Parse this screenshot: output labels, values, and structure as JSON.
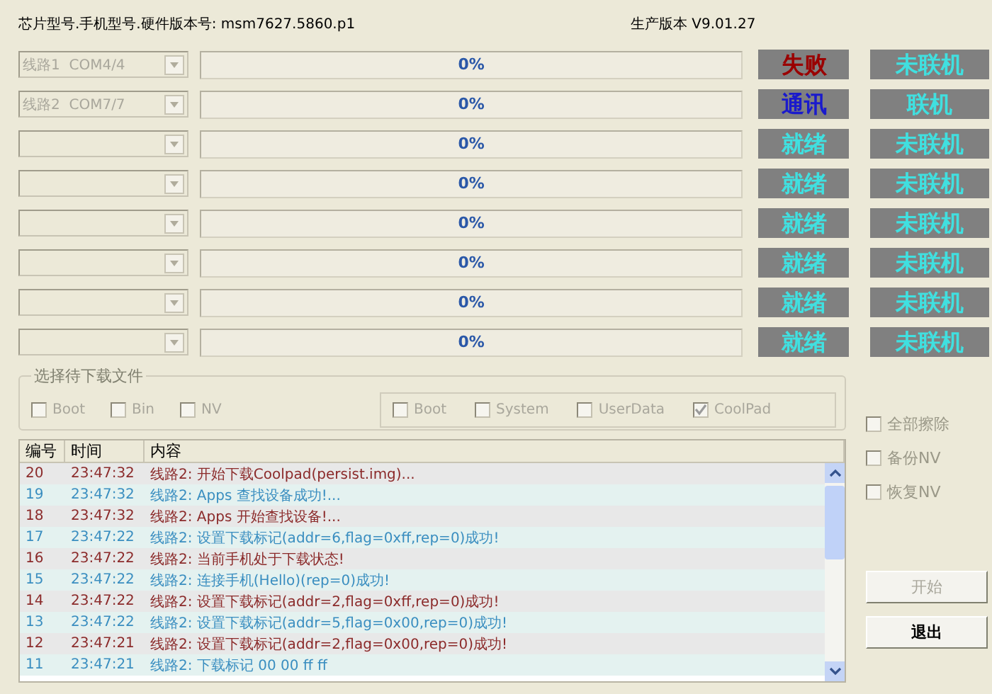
{
  "header": {
    "chip_info": "芯片型号.手机型号.硬件版本号: msm7627.5860.p1",
    "version": "生产版本 V9.01.27"
  },
  "lines": [
    {
      "port": "线路1  COM4/4",
      "disabled": true,
      "progress": "0%",
      "status": {
        "text": "失败",
        "color": "#9a0000"
      },
      "connection": {
        "text": "未联机",
        "color": "#40e0e0"
      }
    },
    {
      "port": "线路2  COM7/7",
      "disabled": true,
      "progress": "0%",
      "status": {
        "text": "通讯",
        "color": "#1a1acc"
      },
      "connection": {
        "text": "联机",
        "color": "#40e0e0"
      }
    },
    {
      "progress": "0%",
      "status": {
        "text": "就绪",
        "color": "#40e0e0"
      },
      "connection": {
        "text": "未联机",
        "color": "#40e0e0"
      }
    },
    {
      "progress": "0%",
      "status": {
        "text": "就绪",
        "color": "#40e0e0"
      },
      "connection": {
        "text": "未联机",
        "color": "#40e0e0"
      }
    },
    {
      "progress": "0%",
      "status": {
        "text": "就绪",
        "color": "#40e0e0"
      },
      "connection": {
        "text": "未联机",
        "color": "#40e0e0"
      }
    },
    {
      "progress": "0%",
      "status": {
        "text": "就绪",
        "color": "#40e0e0"
      },
      "connection": {
        "text": "未联机",
        "color": "#40e0e0"
      }
    },
    {
      "progress": "0%",
      "status": {
        "text": "就绪",
        "color": "#40e0e0"
      },
      "connection": {
        "text": "未联机",
        "color": "#40e0e0"
      }
    },
    {
      "progress": "0%",
      "status": {
        "text": "就绪",
        "color": "#40e0e0"
      },
      "connection": {
        "text": "未联机",
        "color": "#40e0e0"
      }
    }
  ],
  "file_group": {
    "title": "选择待下载文件",
    "left_options": [
      {
        "label": "Boot",
        "checked": false,
        "disabled": true
      },
      {
        "label": "Bin",
        "checked": false,
        "disabled": true
      },
      {
        "label": "NV",
        "checked": false,
        "disabled": true
      }
    ],
    "inner_options": [
      {
        "label": "Boot",
        "checked": false,
        "disabled": true
      },
      {
        "label": "System",
        "checked": false,
        "disabled": true
      },
      {
        "label": "UserData",
        "checked": false,
        "disabled": true
      },
      {
        "label": "CoolPad",
        "checked": true,
        "disabled": true
      }
    ]
  },
  "side_options": [
    {
      "label": "全部擦除",
      "checked": false
    },
    {
      "label": "备份NV",
      "checked": false
    },
    {
      "label": "恢复NV",
      "checked": false
    }
  ],
  "log": {
    "columns": [
      "编号",
      "时间",
      "内容"
    ],
    "rows": [
      {
        "no": "20",
        "time": "23:47:32",
        "content": "线路2: 开始下载Coolpad(persist.img)...",
        "color": "#8b2a2a"
      },
      {
        "no": "19",
        "time": "23:47:32",
        "content": "线路2: Apps 查找设备成功!...",
        "color": "#3a8ec0"
      },
      {
        "no": "18",
        "time": "23:47:32",
        "content": "线路2: Apps 开始查找设备!...",
        "color": "#8b2a2a"
      },
      {
        "no": "17",
        "time": "23:47:22",
        "content": "线路2: 设置下载标记(addr=6,flag=0xff,rep=0)成功!",
        "color": "#3a8ec0"
      },
      {
        "no": "16",
        "time": "23:47:22",
        "content": "线路2: 当前手机处于下载状态!",
        "color": "#8b2a2a"
      },
      {
        "no": "15",
        "time": "23:47:22",
        "content": "线路2: 连接手机(Hello)(rep=0)成功!",
        "color": "#3a8ec0"
      },
      {
        "no": "14",
        "time": "23:47:22",
        "content": "线路2: 设置下载标记(addr=2,flag=0xff,rep=0)成功!",
        "color": "#8b2a2a"
      },
      {
        "no": "13",
        "time": "23:47:22",
        "content": "线路2: 设置下载标记(addr=5,flag=0x00,rep=0)成功!",
        "color": "#3a8ec0"
      },
      {
        "no": "12",
        "time": "23:47:21",
        "content": "线路2: 设置下载标记(addr=2,flag=0x00,rep=0)成功!",
        "color": "#8b2a2a"
      },
      {
        "no": "11",
        "time": "23:47:21",
        "content": "线路2: 下载标记 00 00 ff ff",
        "color": "#3a8ec0"
      }
    ]
  },
  "buttons": [
    {
      "label": "开始",
      "disabled": true
    },
    {
      "label": "退出",
      "disabled": false
    }
  ]
}
